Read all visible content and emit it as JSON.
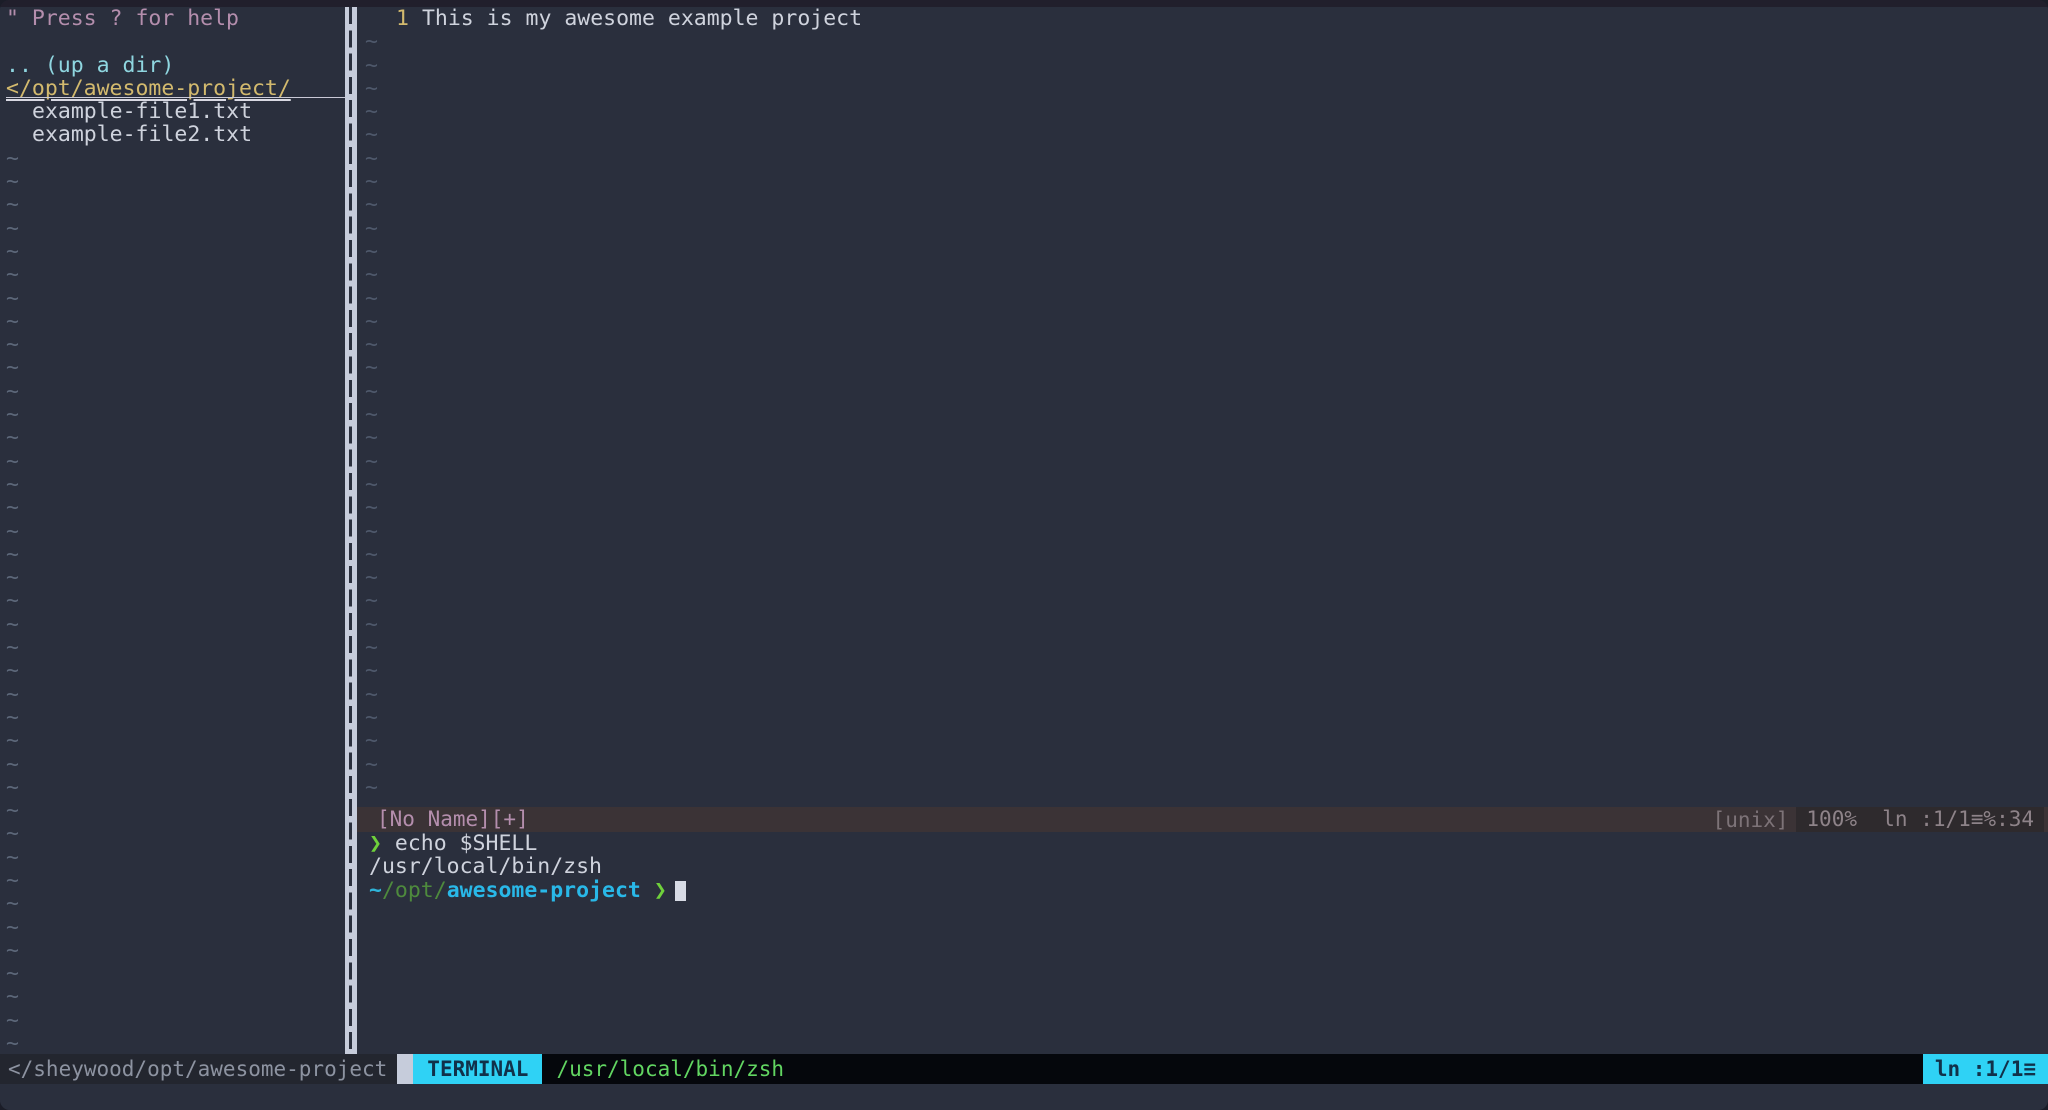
{
  "theme": {
    "bg": "#2a2f3d",
    "fg": "#cfd3dd",
    "accent_cyan": "#2fd2f5",
    "accent_green": "#62d662",
    "accent_yellow": "#d3ba6e",
    "accent_purple": "#b48ead",
    "tilde": "#4e586b",
    "statusline_bg": "#3b3336",
    "bottombar_bg": "#05070c"
  },
  "explorer": {
    "help_hint": "\" Press ? for help",
    "blank_after_help": "",
    "up_a_dir": ".. (up a dir)",
    "root_label": "</opt/awesome-project/",
    "files": [
      "example-file1.txt",
      "example-file2.txt"
    ],
    "filler_glyph": "~",
    "filler_count": 41
  },
  "editor": {
    "lines": [
      {
        "number": "1",
        "text": "This is my awesome example project"
      }
    ],
    "filler_glyph": "~",
    "filler_count": 33
  },
  "statusline": {
    "buffer_name": "[No Name][+]",
    "fileformat": "[unix]",
    "percent": "100%",
    "position": "ln :1/1≡%:34"
  },
  "terminal": {
    "lines": [
      {
        "kind": "command",
        "chevron": "❯",
        "text": "echo $SHELL"
      },
      {
        "kind": "output",
        "text": "/usr/local/bin/zsh"
      }
    ],
    "prompt": {
      "tilde": "~",
      "path_dim": "/opt/",
      "path_bold": "awesome-project",
      "chevron": "❯"
    }
  },
  "bottombar": {
    "path": "</sheywood/opt/awesome-project",
    "mode": "TERMINAL",
    "shell": "/usr/local/bin/zsh",
    "position": "ln :1/1≡"
  }
}
